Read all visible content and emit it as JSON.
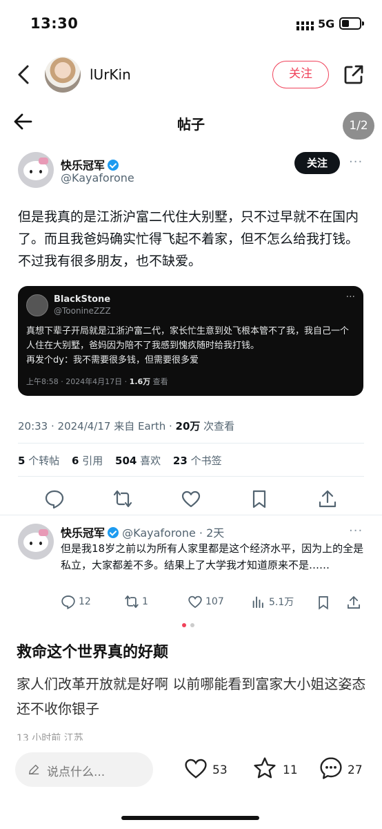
{
  "status_bar": {
    "time": "13:30",
    "network": "5G"
  },
  "header": {
    "username": "lUrKin",
    "follow_label": "关注"
  },
  "screenshot": {
    "bar_title": "帖子",
    "page_indicator": "1/2",
    "post": {
      "author_name": "快乐冠军",
      "author_handle": "@Kayaforone",
      "follow_label": "关注",
      "body": "但是我真的是江浙沪富二代住大别墅，只不过早就不在国内了。而且我爸妈确实忙得飞起不着家，但不怎么给我打钱。不过我有很多朋友，也不缺爱。",
      "quote": {
        "name": "BlackStone",
        "handle": "@ToonineZZZ",
        "text": "真想下辈子开局就是江浙沪富二代，家长忙生意到处飞根本管不了我，我自己一个人住在大别墅，爸妈因为陪不了我感到愧疚随时给我打钱。\n再发个dy：我不需要很多钱，但需要很多爱",
        "time": "上午8:58 · 2024年4月17日 · ",
        "views": "1.6万",
        "views_suffix": " 查看"
      },
      "timestamp": "20:33 · 2024/4/17 来自 Earth · ",
      "view_count": "20万",
      "view_suffix": " 次查看",
      "stats": [
        {
          "count": "5",
          "label": "个转帖"
        },
        {
          "count": "6",
          "label": "引用"
        },
        {
          "count": "504",
          "label": "喜欢"
        },
        {
          "count": "23",
          "label": "个书签"
        }
      ]
    },
    "reply": {
      "author_name": "快乐冠军",
      "handle_time": "@Kayaforone · 2天",
      "body": "但是我18岁之前以为所有人家里都是这个经济水平，因为上的全是私立，大家都差不多。结果上了大学我才知道原来不是……",
      "replies": "12",
      "retweets": "1",
      "likes": "107",
      "views": "5.1万"
    }
  },
  "note": {
    "title": "救命这个世界真的好颠",
    "body": "家人们改革开放就是好啊 以前哪能看到富家大小姐这姿态 还不收你银子",
    "meta": "13 小时前 江苏"
  },
  "bottom_bar": {
    "comment_placeholder": "说点什么...",
    "likes": "53",
    "favorites": "11",
    "comments": "27"
  },
  "colors": {
    "accent": "#f0425a",
    "verified": "#1d9bf0"
  }
}
